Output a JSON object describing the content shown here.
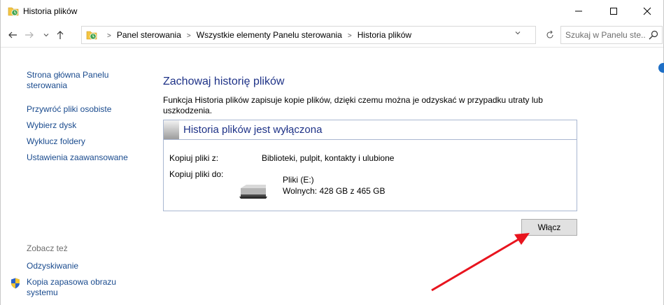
{
  "window": {
    "title": "Historia plików"
  },
  "nav": {
    "breadcrumbs": [
      "Panel sterowania",
      "Wszystkie elementy Panelu sterowania",
      "Historia plików"
    ],
    "search_placeholder": "Szukaj w Panelu ste..."
  },
  "sidebar": {
    "items": [
      {
        "label": "Strona główna Panelu sterowania"
      },
      {
        "label": "Przywróć pliki osobiste"
      },
      {
        "label": "Wybierz dysk"
      },
      {
        "label": "Wyklucz foldery"
      },
      {
        "label": "Ustawienia zaawansowane"
      }
    ],
    "see_also_label": "Zobacz też",
    "see_also": [
      {
        "label": "Odzyskiwanie"
      },
      {
        "label": "Kopia zapasowa obrazu systemu"
      }
    ]
  },
  "main": {
    "heading": "Zachowaj historię plików",
    "description": "Funkcja Historia plików zapisuje kopie plików, dzięki czemu można je odzyskać w przypadku utraty lub uszkodzenia.",
    "status_title": "Historia plików jest wyłączona",
    "copy_from_label": "Kopiuj pliki z:",
    "copy_from_value": "Biblioteki, pulpit, kontakty i ulubione",
    "copy_to_label": "Kopiuj pliki do:",
    "drive_name": "Pliki (E:)",
    "drive_free": "Wolnych: 428 GB z 465 GB",
    "enable_button": "Włącz"
  },
  "colors": {
    "link": "#1a4b8e",
    "heading": "#1e3287",
    "annotation_arrow": "#e8141e"
  }
}
